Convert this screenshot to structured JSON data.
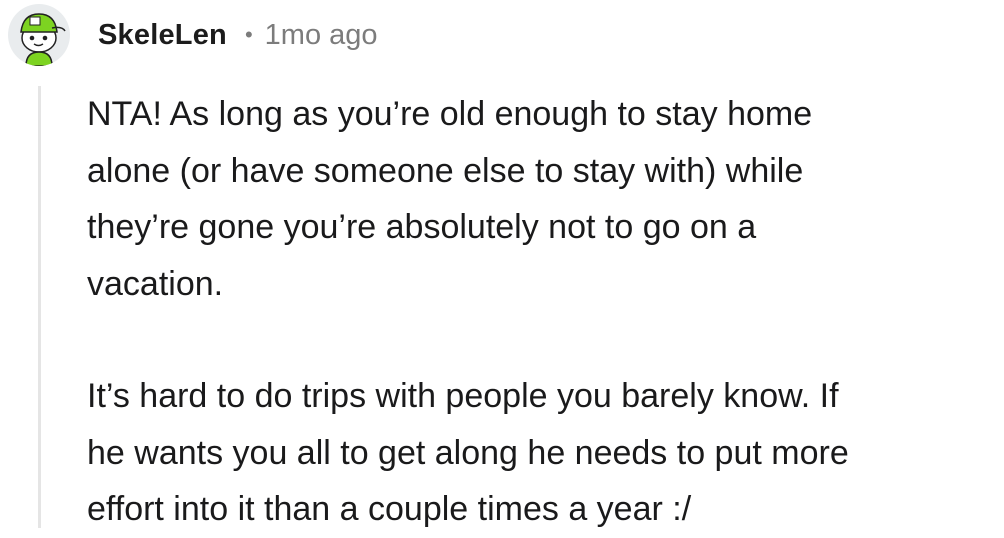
{
  "comment": {
    "username": "SkeleLen",
    "separator": "•",
    "age": "1mo ago",
    "avatar_icon": "snoo-avatar-green-cap-icon",
    "paragraphs": [
      {
        "lines": [
          "NTA! As long as you’re old enough to stay home",
          "alone (or have someone else to stay with) while",
          "they’re gone you’re absolutely not to go on a",
          "vacation."
        ]
      },
      {
        "lines": [
          "It’s hard to do trips with people you barely know. If",
          "he wants you all to get along he needs to put more",
          "effort into it than a couple times a year :/"
        ]
      }
    ]
  },
  "colors": {
    "username": "#1c1c1c",
    "meta": "#7c7c7c",
    "body_text": "#1a1a1b",
    "thread_line": "#e5e5e5",
    "avatar_cap": "#7dd321",
    "avatar_bg": "#e9ecee"
  }
}
